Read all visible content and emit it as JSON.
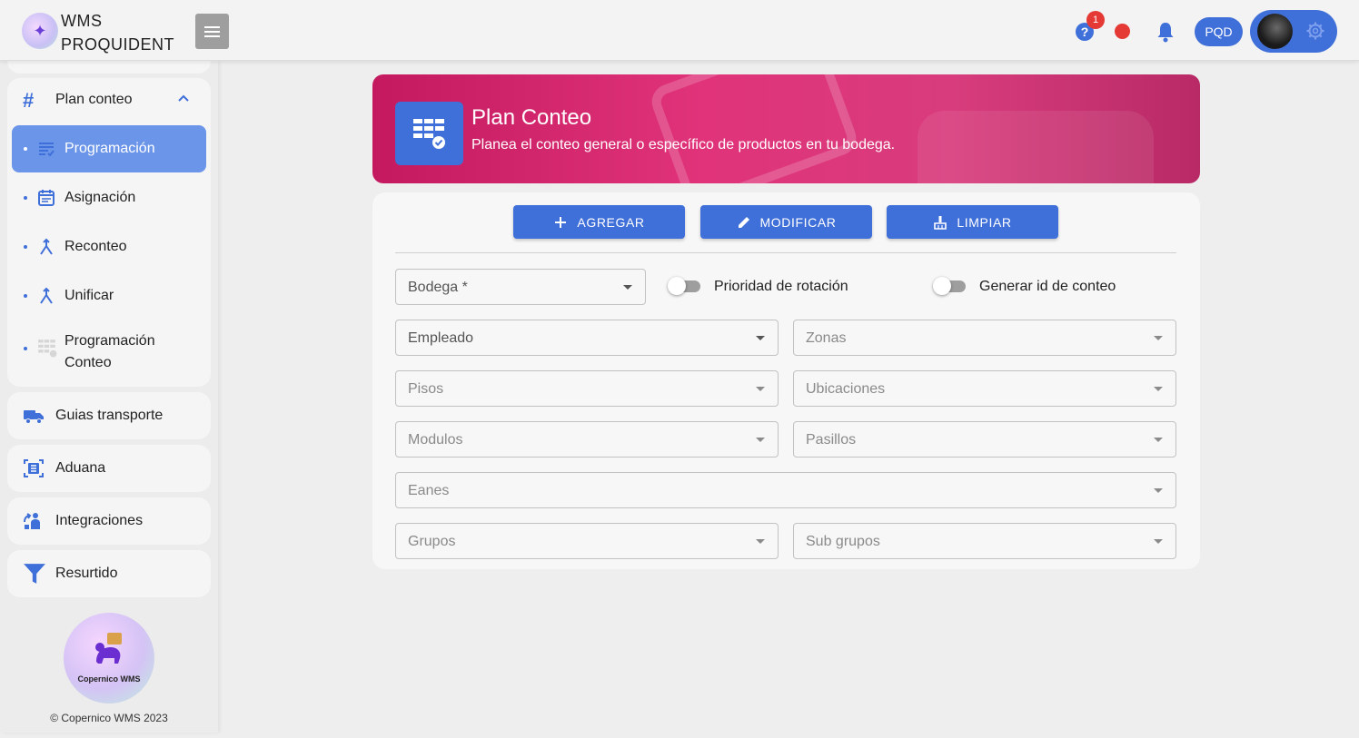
{
  "header": {
    "brand_name": "WMS PROQUIDENT",
    "help_badge_count": "1",
    "company_code": "PQD",
    "colors": {
      "primary": "#3f6fd8",
      "alert": "#e53935",
      "banner": "#d42e72"
    }
  },
  "sidebar": {
    "group": {
      "label": "Plan conteo",
      "items": [
        {
          "label": "Programación",
          "icon": "list-check-icon",
          "active": true
        },
        {
          "label": "Asignación",
          "icon": "calendar-icon",
          "active": false
        },
        {
          "label": "Reconteo",
          "icon": "merge-icon",
          "active": false
        },
        {
          "label": "Unificar",
          "icon": "merge-icon",
          "active": false
        },
        {
          "label": "Programación Conteo",
          "icon": "grid-check-icon",
          "active": false
        }
      ]
    },
    "cards": [
      {
        "label": "Guias transporte",
        "icon": "truck-icon"
      },
      {
        "label": "Aduana",
        "icon": "customs-icon"
      },
      {
        "label": "Integraciones",
        "icon": "integration-icon"
      },
      {
        "label": "Resurtido",
        "icon": "filter-icon"
      }
    ],
    "footer_logo_text": "Copernico WMS",
    "copyright": "© Copernico WMS 2023"
  },
  "banner": {
    "title": "Plan Conteo",
    "subtitle": "Planea el conteo general o específico de productos en tu bodega."
  },
  "toolbar": {
    "add_label": "AGREGAR",
    "modify_label": "MODIFICAR",
    "clear_label": "LIMPIAR"
  },
  "form": {
    "bodega": "Bodega *",
    "rotation_priority_label": "Prioridad de rotación",
    "rotation_priority_on": false,
    "generate_id_label": "Generar id de conteo",
    "generate_id_on": false,
    "empleado": "Empleado",
    "zonas": "Zonas",
    "pisos": "Pisos",
    "ubicaciones": "Ubicaciones",
    "modulos": "Modulos",
    "pasillos": "Pasillos",
    "eanes": "Eanes",
    "grupos": "Grupos",
    "sub_grupos": "Sub grupos"
  }
}
